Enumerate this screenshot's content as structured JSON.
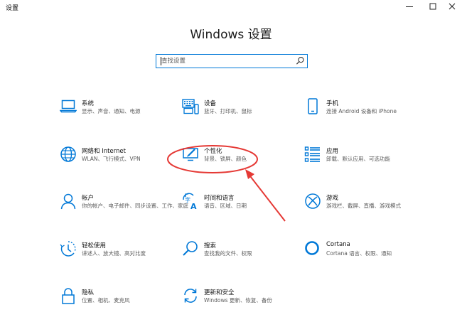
{
  "window": {
    "title": "设置",
    "buttons": {
      "minimize": "─",
      "maximize": "☐",
      "close": "✕"
    }
  },
  "page": {
    "heading": "Windows 设置"
  },
  "search": {
    "placeholder": "查找设置",
    "icon": "search-icon"
  },
  "accent_color": "#0078d7",
  "annotation_color": "#e53935",
  "tiles": [
    {
      "id": "system",
      "icon": "laptop-icon",
      "label": "系统",
      "description": "显示、声音、通知、电源"
    },
    {
      "id": "devices",
      "icon": "keyboard-icon",
      "label": "设备",
      "description": "蓝牙、打印机、鼠标"
    },
    {
      "id": "phone",
      "icon": "phone-icon",
      "label": "手机",
      "description": "连接 Android 设备和 iPhone"
    },
    {
      "id": "network",
      "icon": "globe-icon",
      "label": "网络和 Internet",
      "description": "WLAN、飞行模式、VPN"
    },
    {
      "id": "personalization",
      "icon": "personalization-icon",
      "label": "个性化",
      "description": "背景、锁屏、颜色"
    },
    {
      "id": "apps",
      "icon": "apps-list-icon",
      "label": "应用",
      "description": "卸载、默认应用、可选功能"
    },
    {
      "id": "accounts",
      "icon": "person-icon",
      "label": "帐户",
      "description": "你的帐户、电子邮件、同步设置、工作、家庭"
    },
    {
      "id": "time-language",
      "icon": "time-language-icon",
      "label": "时间和语言",
      "description": "语音、区域、日期"
    },
    {
      "id": "gaming",
      "icon": "xbox-icon",
      "label": "游戏",
      "description": "游戏栏、截屏、直播、游戏模式"
    },
    {
      "id": "ease-of-access",
      "icon": "ease-of-access-icon",
      "label": "轻松使用",
      "description": "讲述人、放大镜、高对比度"
    },
    {
      "id": "search",
      "icon": "magnifier-icon",
      "label": "搜索",
      "description": "查找我的文件、权限"
    },
    {
      "id": "cortana",
      "icon": "cortana-ring-icon",
      "label": "Cortana",
      "description": "Cortana 语言、权限、通知"
    },
    {
      "id": "privacy",
      "icon": "lock-icon",
      "label": "隐私",
      "description": "位置、相机、麦克风"
    },
    {
      "id": "update-security",
      "icon": "sync-arrows-icon",
      "label": "更新和安全",
      "description": "Windows 更新、恢复、备份"
    }
  ]
}
